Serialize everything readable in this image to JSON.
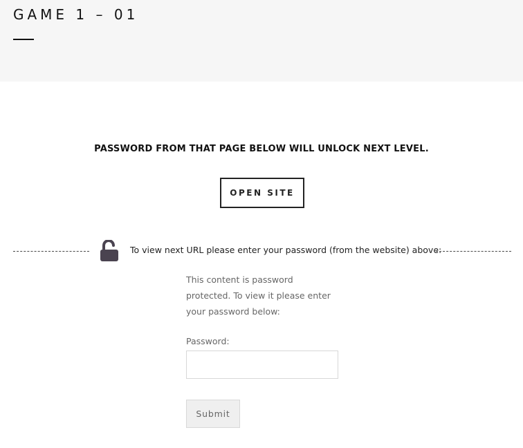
{
  "header": {
    "title": "GAME 1 – 01"
  },
  "main": {
    "headline": "PASSWORD FROM THAT PAGE BELOW WILL UNLOCK NEXT LEVEL.",
    "open_site_label": "OPEN SITE",
    "unlock_prompt": "To view next URL please enter your password (from the website) above:",
    "lock_icon": "unlocked-padlock-icon",
    "lock_color": "#4a4350"
  },
  "password_form": {
    "notice": "This content is password protected. To view it please enter your password below:",
    "password_label": "Password:",
    "password_value": "",
    "submit_label": "Submit"
  },
  "colors": {
    "title_bar_bg": "#f6f6f6",
    "text_dark": "#111111",
    "text_muted": "#666666"
  }
}
